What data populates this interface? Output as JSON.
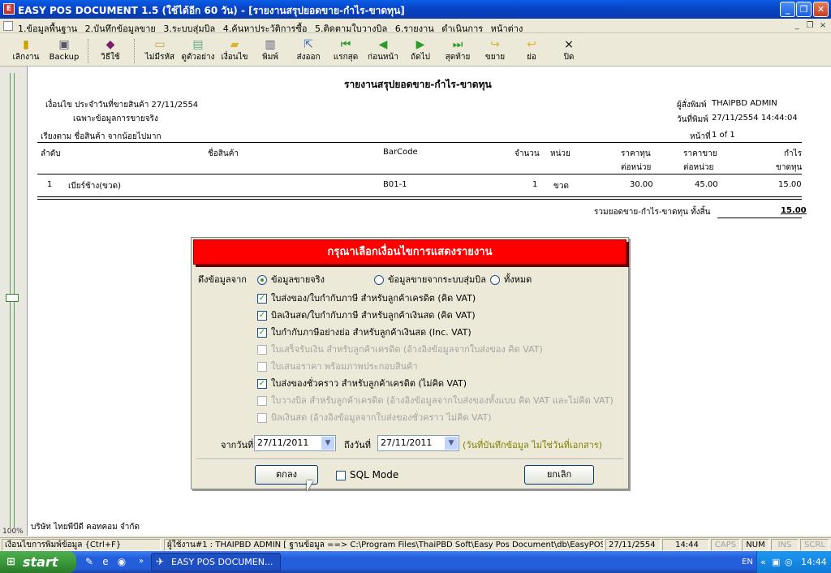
{
  "window": {
    "title": "EASY POS DOCUMENT 1.5 (ใช้ได้อีก 60 วัน) - [รายงานสรุปยอดขาย-กำไร-ขาดทุน]",
    "btn_minimize": "_",
    "btn_restore": "❐",
    "btn_close": "✕"
  },
  "menu": {
    "items": [
      "1.ข้อมูลพื้นฐาน",
      "2.บันทึกข้อมูลขาย",
      "3.ระบบสุ่มบิล",
      "4.ค้นหาประวัติการซื้อ",
      "5.ติดตามใบวางบิล",
      "6.รายงาน",
      "ดำเนินการ",
      "หน้าต่าง"
    ],
    "mdi_minimize": "_",
    "mdi_restore": "❐",
    "mdi_close": "×"
  },
  "toolbar": {
    "exit_label": "เลิกงาน",
    "backup_label": "Backup",
    "howto_label": "วิธีใช้",
    "no_password_label": "ไม่มีรหัส",
    "preview_label": "ดูตัวอย่าง",
    "condition_label": "เงื่อนไข",
    "print_label": "พิมพ์",
    "export_label": "ส่งออก",
    "first_label": "แรกสุด",
    "prev_label": "ก่อนหน้า",
    "next_label": "ถัดไป",
    "last_label": "สุดท้าย",
    "expand_label": "ขยาย",
    "shrink_label": "ย่อ",
    "close_label": "ปิด"
  },
  "report": {
    "title": "รายงานสรุปยอดขาย-กำไร-ขาดทุน",
    "condition_line": "เงื่อนไข ประจำวันที่ขายสินค้า 27/11/2554",
    "real_sales_only": "เฉพาะข้อมูลการขายจริง",
    "sort_line": "เรียงตาม ชื่อสินค้า จากน้อยไปมาก",
    "printer_label": "ผู้สั่งพิมพ์",
    "printer_value": "THAIPBD  ADMIN",
    "print_date_label": "วันที่พิมพ์",
    "print_date_value": "27/11/2554 14:44:04",
    "page_label": "หน้าที่",
    "page_value": "1 of 1",
    "columns": {
      "no": "ลำดับ",
      "name": "ชื่อสินค้า",
      "barcode": "BarCode",
      "qty": "จำนวน",
      "unit": "หน่วย",
      "cost_1": "ราคาทุน",
      "cost_2": "ต่อหน่วย",
      "price_1": "ราคาขาย",
      "price_2": "ต่อหน่วย",
      "profit_1": "กำไร",
      "profit_2": "ขาดทุน"
    },
    "rows": [
      {
        "no": "1",
        "name": "เบียร์ช้าง(ขวด)",
        "barcode": "B01-1",
        "qty": "1",
        "unit": "ขวด",
        "cost": "30.00",
        "price": "45.00",
        "profit": "15.00"
      }
    ],
    "total_label": "รวมยอดขาย-กำไร-ขาดทุน ทั้งสิ้น",
    "total_value": "15.00",
    "footer_company": "บริษัท ไทยพีบีดี คอทคอม จำกัด",
    "zoom": "100%"
  },
  "dialog": {
    "title": "กรุณาเลือกเงื่อนไขการแสดงรายงาน",
    "pull_from_label": "ดึงข้อมูลจาก",
    "radios": [
      {
        "label": "ข้อมูลขายจริง",
        "selected": true
      },
      {
        "label": "ข้อมูลขายจากระบบสุ่มบิล",
        "selected": false
      },
      {
        "label": "ทั้งหมด",
        "selected": false
      }
    ],
    "checkboxes": [
      {
        "label": "ใบส่งของ/ใบกำกับภาษี สำหรับลูกค้าเครดิต (คิด VAT)",
        "checked": true,
        "enabled": true
      },
      {
        "label": "บิลเงินสด/ใบกำกับภาษี สำหรับลูกค้าเงินสด (คิด VAT)",
        "checked": true,
        "enabled": true
      },
      {
        "label": "ใบกำกับภาษีอย่างย่อ สำหรับลูกค้าเงินสด (Inc. VAT)",
        "checked": true,
        "enabled": true
      },
      {
        "label": "ใบเสร็จรับเงิน สำหรับลูกค้าเครดิต (อ้างอิงข้อมูลจากใบส่งของ คิด VAT)",
        "checked": false,
        "enabled": false
      },
      {
        "label": "ใบเสนอราคา พร้อมภาพประกอบสินค้า",
        "checked": false,
        "enabled": false
      },
      {
        "label": "ใบส่งของชั่วคราว สำหรับลูกค้าเครดิต (ไม่คิด VAT)",
        "checked": true,
        "enabled": true
      },
      {
        "label": "ใบวางบิล สำหรับลูกค้าเครดิต (อ้างอิงข้อมูลจากใบส่งของทั้งแบบ คิด VAT และไม่คิด VAT)",
        "checked": false,
        "enabled": false
      },
      {
        "label": "บิลเงินสด (อ้างอิงข้อมูลจากใบส่งของชั่วคราว ไม่คิด VAT)",
        "checked": false,
        "enabled": false
      }
    ],
    "from_date_label": "จากวันที่",
    "from_date_value": "27/11/2011",
    "to_date_label": "ถึงวันที่",
    "to_date_value": "27/11/2011",
    "date_note": "(วันที่บันทึกข้อมูล ไม่ใช่วันที่เอกสาร)",
    "ok_label": "ตกลง",
    "sql_mode_label": "SQL Mode",
    "cancel_label": "ยกเลิก"
  },
  "status": {
    "hint": "เงื่อนไขการพิมพ์ข้อมูล {Ctrl+F}",
    "user_db": "ผู้ใช้งาน#1 : THAIPBD  ADMIN [ ฐานข้อมูล ==> C:\\Program Files\\ThaiPBD Soft\\Easy Pos Document\\db\\EasyPOS-A.pbd ]",
    "date": "27/11/2554",
    "time": "14:44",
    "caps": "CAPS",
    "num": "NUM",
    "ins": "INS",
    "scrl": "SCRL"
  },
  "taskbar": {
    "start_label": "start",
    "task_label": "EASY POS DOCUMEN...",
    "lang": "EN",
    "clock": "14:44"
  },
  "colors": {
    "dialog_header": "#ff0000",
    "checkmark": "#21a121",
    "date_note": "#808000"
  }
}
